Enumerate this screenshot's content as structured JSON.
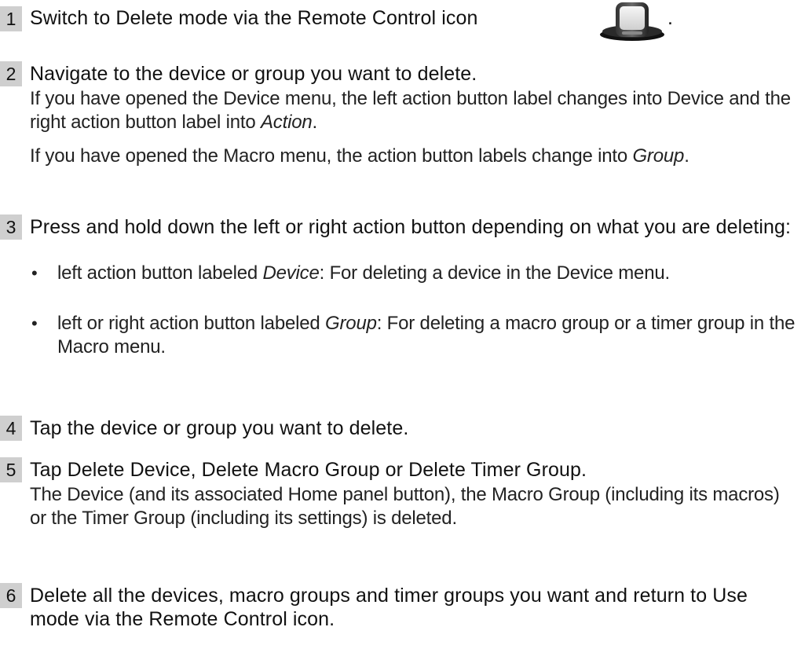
{
  "steps": [
    {
      "number": "1",
      "heading": "Switch to Delete mode via the Remote Control icon",
      "heading_suffix": "."
    },
    {
      "number": "2",
      "heading": "Navigate to the device or group you want to delete.",
      "para1_a": "If you have opened the Device menu, the left action button label changes into Device and the right action button label into ",
      "para1_b": "Action",
      "para1_c": ".",
      "para2_a": "If you have opened the Macro menu, the action button labels change into ",
      "para2_b": "Group",
      "para2_c": "."
    },
    {
      "number": "3",
      "heading": "Press and hold down the left or right action button depending on what you are deleting:",
      "bullets": [
        {
          "dot": "•",
          "a": "left action button labeled ",
          "b": "Device",
          "c": ": For deleting a device in the Device menu."
        },
        {
          "dot": "•",
          "a": "left or right action button labeled ",
          "b": "Group",
          "c": ": For deleting a macro group or a timer group in the Macro menu."
        }
      ]
    },
    {
      "number": "4",
      "heading": "Tap the device or group you want to delete."
    },
    {
      "number": "5",
      "heading": "Tap Delete Device, Delete Macro Group or Delete Timer Group.",
      "body": "The Device (and its associated Home panel button), the Macro Group (including its macros) or the Timer Group (including its settings) is deleted."
    },
    {
      "number": "6",
      "heading": "Delete all the devices, macro groups and timer groups you want and return to Use mode via the Remote Control icon."
    }
  ],
  "icons": {
    "remote_control": "remote-control-icon"
  }
}
